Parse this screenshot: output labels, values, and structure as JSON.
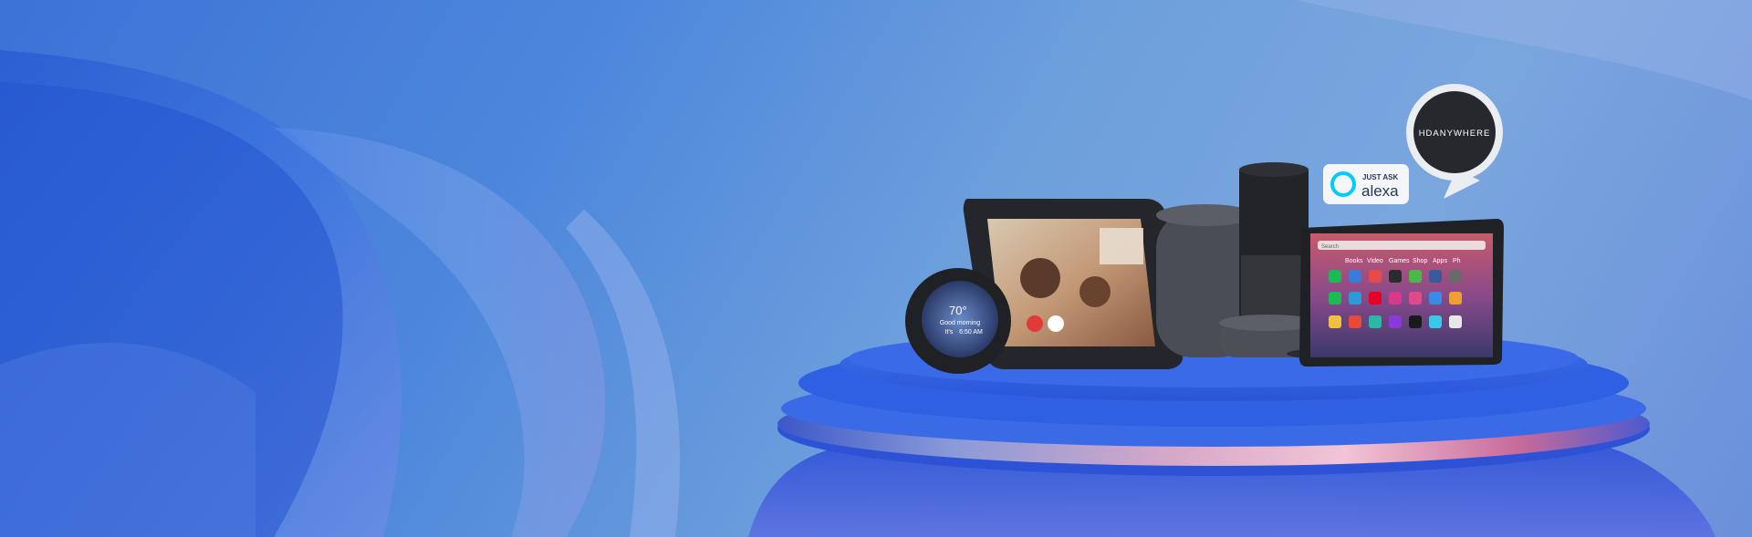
{
  "hero": {
    "brand_badge": {
      "label": "HDANYWHERE"
    },
    "alexa_badge": {
      "line1": "JUST ASK",
      "line2": "alexa"
    },
    "echo_spot": {
      "temperature": "70°",
      "greeting": "Good morning",
      "time_prefix": "It's",
      "time": "6:50 AM"
    },
    "fire_tablet": {
      "search_placeholder": "Search",
      "nav": [
        "Books",
        "Video",
        "Games",
        "Shop",
        "Apps",
        "Ph"
      ]
    }
  },
  "colors": {
    "background": "#4d87dc",
    "pedestal": "#2f62e0",
    "device_dark": "#2a2c31",
    "fabric": "#4a4d55",
    "alexa_blue": "#00caff",
    "badge_dark": "#26282d"
  },
  "icons": [
    "alexa-ring-icon",
    "speech-bubble-icon",
    "hangup-icon",
    "video-icon",
    "search-icon"
  ]
}
